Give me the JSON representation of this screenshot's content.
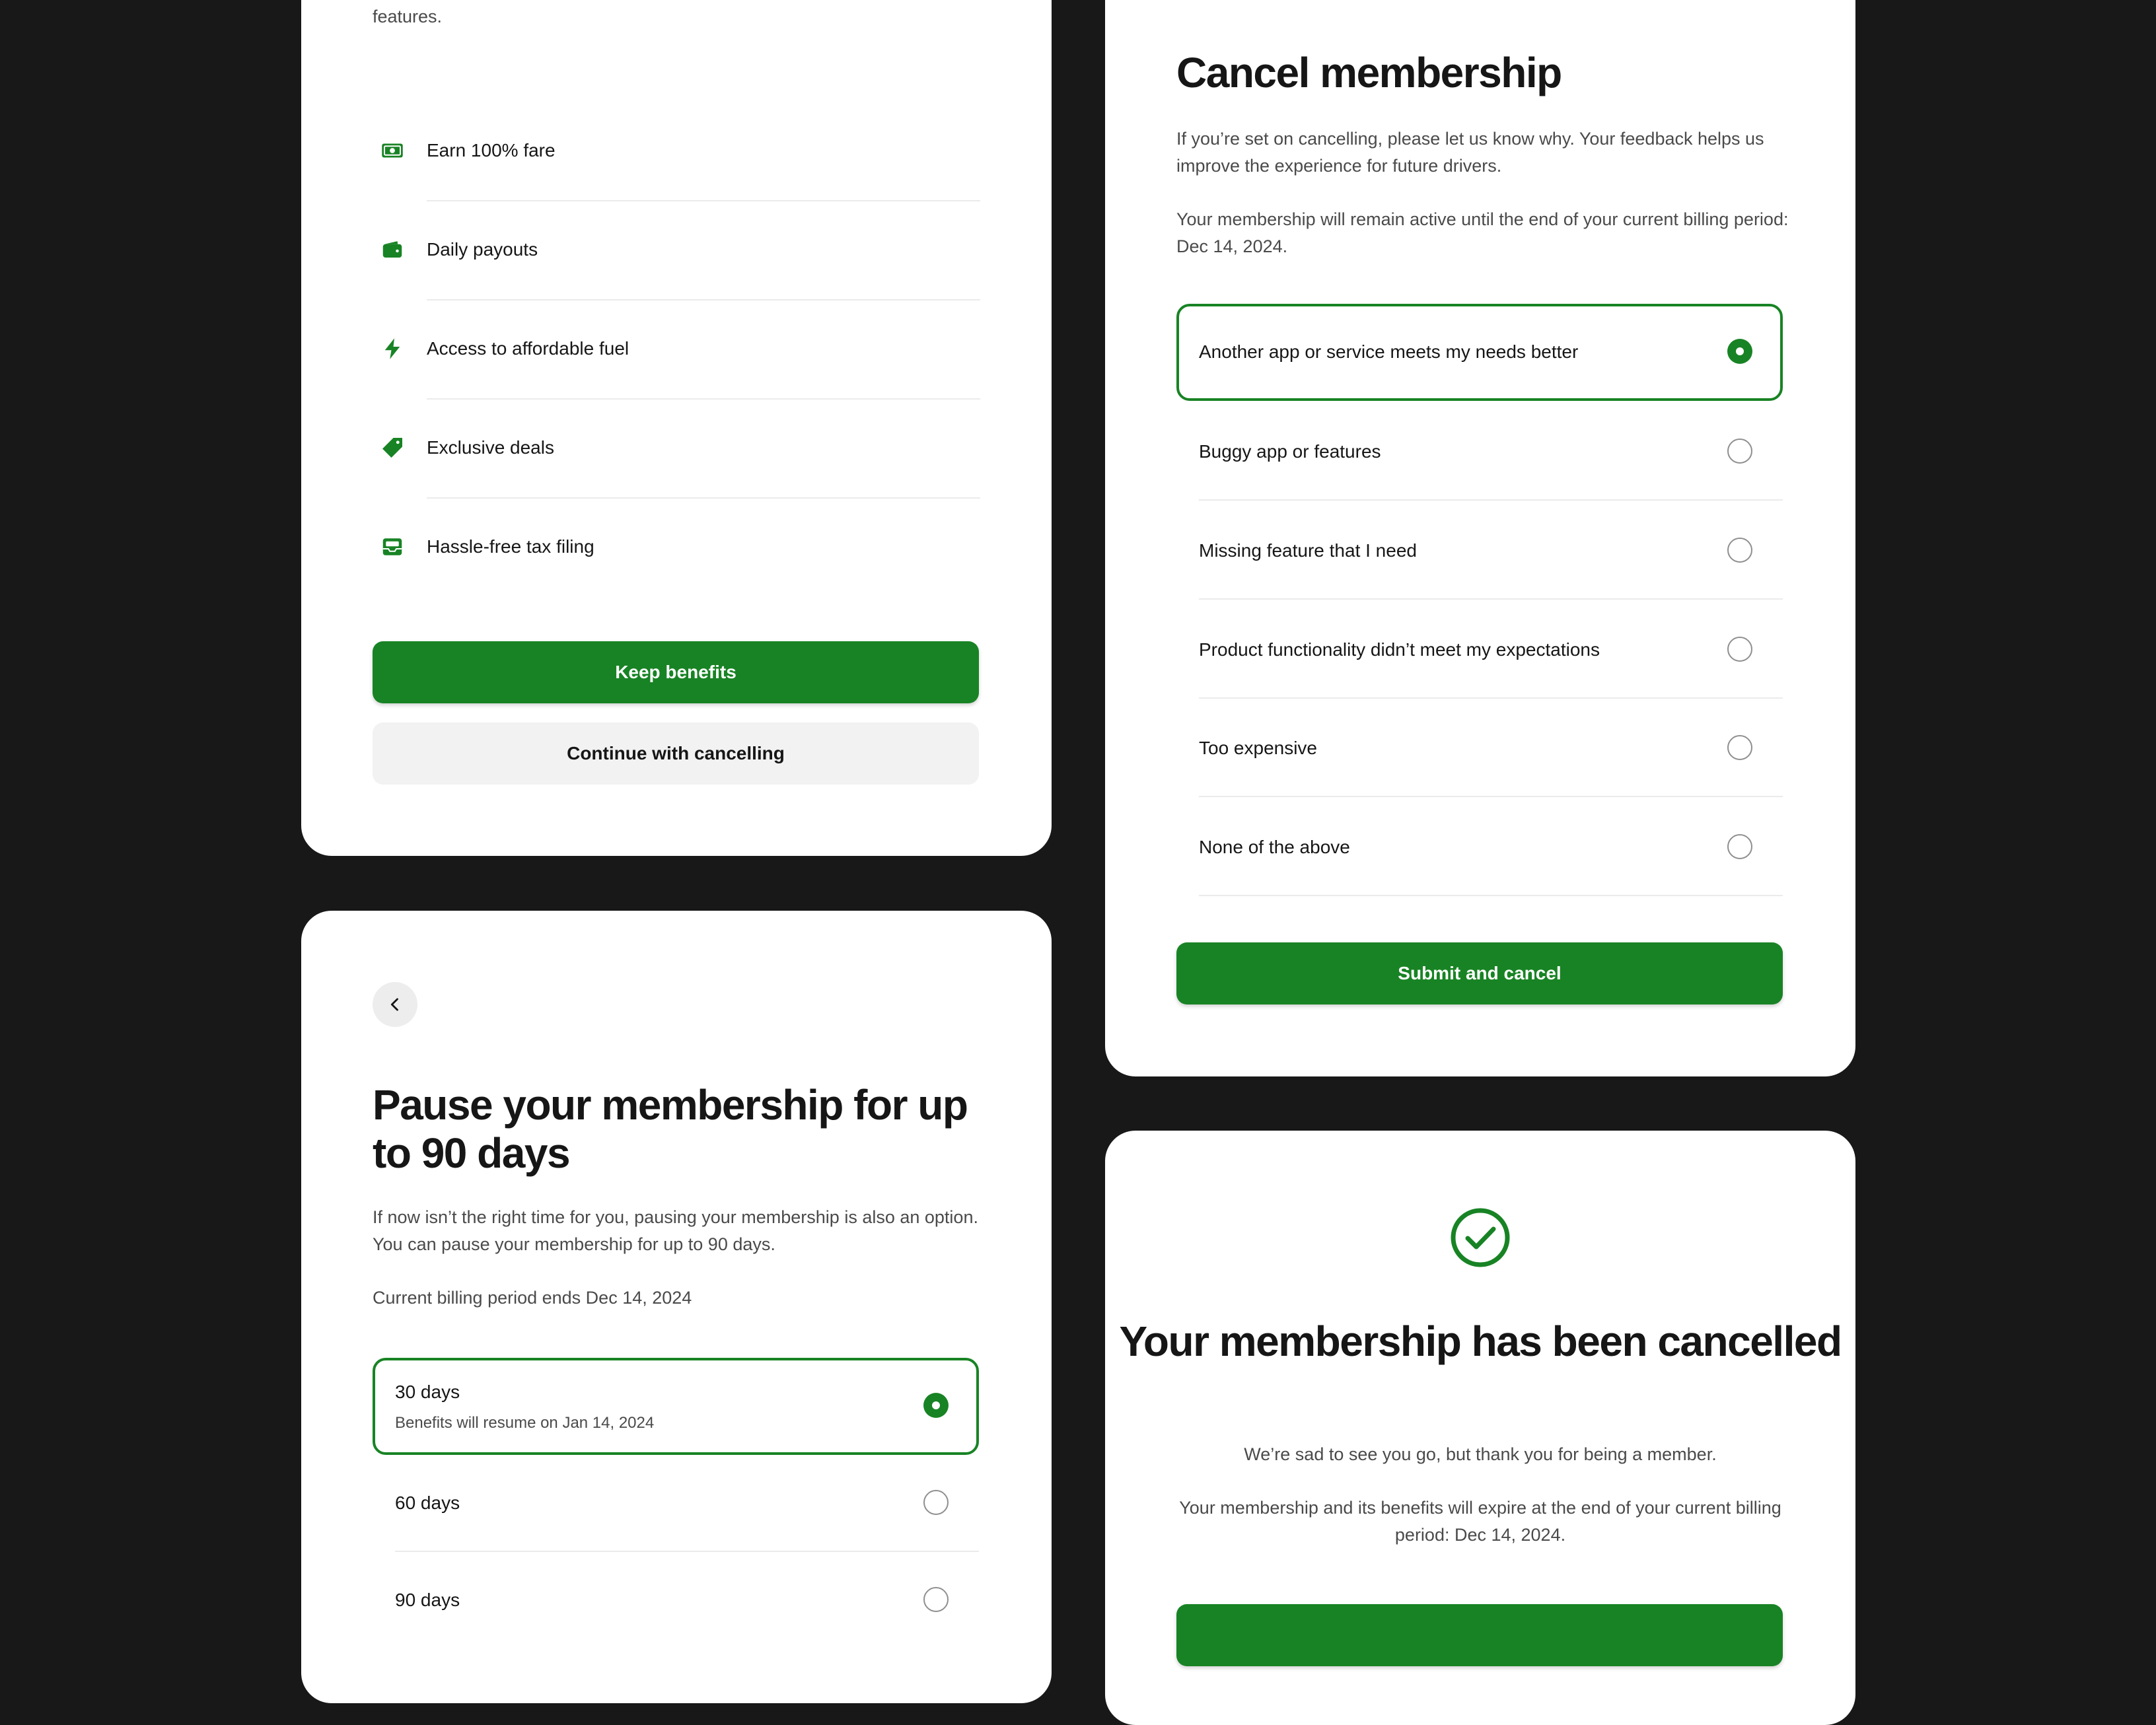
{
  "colors": {
    "accent": "#188324",
    "background": "#181818",
    "card": "#ffffff",
    "secondary_button": "#f2f2f3"
  },
  "benefits_card": {
    "intro_fragment": "features.",
    "items": [
      {
        "icon": "money-icon",
        "label": "Earn 100% fare"
      },
      {
        "icon": "wallet-icon",
        "label": "Daily payouts"
      },
      {
        "icon": "lightning-icon",
        "label": "Access to affordable fuel"
      },
      {
        "icon": "tag-icon",
        "label": "Exclusive deals"
      },
      {
        "icon": "tax-inbox-icon",
        "label": "Hassle-free tax filing"
      }
    ],
    "primary_label": "Keep benefits",
    "secondary_label": "Continue with cancelling"
  },
  "pause_card": {
    "title": "Pause your membership for up to 90 days",
    "description": "If now isn’t the right time for you, pausing your membership is also an option. You can pause your membership for up to 90 days.",
    "billing_note": "Current billing period ends Dec 14, 2024",
    "options": [
      {
        "label": "30 days",
        "sublabel": "Benefits will resume on Jan 14, 2024",
        "selected": true
      },
      {
        "label": "60 days",
        "selected": false
      },
      {
        "label": "90 days",
        "selected": false
      }
    ]
  },
  "cancel_card": {
    "title": "Cancel membership",
    "description": "If you’re set on cancelling, please let us know why. Your feedback helps us improve the experience for future drivers.",
    "active_note": "Your membership will remain active until the end of your current billing period: Dec 14, 2024.",
    "reasons": [
      {
        "label": "Another app or service meets my needs better",
        "selected": true
      },
      {
        "label": "Buggy app or features",
        "selected": false
      },
      {
        "label": "Missing feature that I need",
        "selected": false
      },
      {
        "label": "Product functionality didn’t meet my expectations",
        "selected": false
      },
      {
        "label": "Too expensive",
        "selected": false
      },
      {
        "label": "None of the above",
        "selected": false
      }
    ],
    "submit_label": "Submit and cancel"
  },
  "done_card": {
    "icon": "check-circle-icon",
    "title": "Your membership has been cancelled",
    "message": "We’re sad to see you go, but thank you for being a member.",
    "expire_note": "Your membership and its benefits will expire at the end of your current billing period: Dec 14, 2024."
  }
}
